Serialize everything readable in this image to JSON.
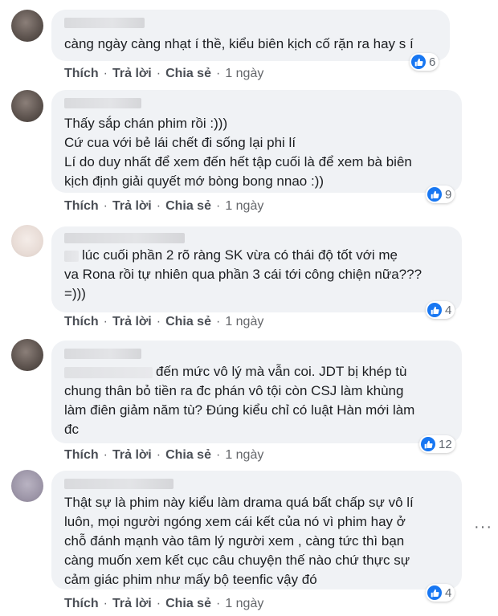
{
  "actions": {
    "like": "Thích",
    "reply": "Trả lời",
    "share": "Chia sẻ",
    "sep": "·"
  },
  "comments": [
    {
      "lines": [
        "càng ngày càng nhạt í thề, kiểu biên kịch cố rặn ra hay s í"
      ],
      "reactions": "6",
      "time": "1 ngày"
    },
    {
      "lines": [
        "Thấy sắp chán phim rồi :)))",
        "Cứ cua với bẻ lái chết đi sống lại phi lí",
        "Lí do duy nhất để xem đến hết tập cuối là để xem bà biên",
        "kịch định giải quyết mớ bòng bong nnao :))"
      ],
      "reactions": "9",
      "time": "1 ngày"
    },
    {
      "lines": [
        "lúc cuối phần 2 rõ ràng SK vừa có thái độ tốt với mẹ",
        "va Rona rồi tự nhiên qua phần 3 cái tới công chiện nữa???",
        "=)))"
      ],
      "reactions": "4",
      "time": "1 ngày"
    },
    {
      "lines": [
        "đến mức vô lý mà vẫn coi. JDT bị khép tù",
        "chung thân bỏ tiền ra đc phán vô tội còn CSJ làm khùng",
        "làm điên giảm năm tù? Đúng kiểu chỉ có luật Hàn mới làm",
        "đc"
      ],
      "reactions": "12",
      "time": "1 ngày"
    },
    {
      "lines": [
        "Thật sự là phim này kiểu làm drama quá bất chấp sự vô lí",
        "luôn, mọi người ngóng xem cái kết của nó vì phim hay ở",
        "chỗ đánh mạnh vào tâm lý người xem , càng tức thì bạn",
        "càng muốn xem kết cục câu chuyện thế nào chứ thực sự",
        "cảm giác phim như mấy bộ teenfic vậy đó"
      ],
      "reactions": "4",
      "time": "1 ngày"
    }
  ],
  "more_glyph": "···"
}
